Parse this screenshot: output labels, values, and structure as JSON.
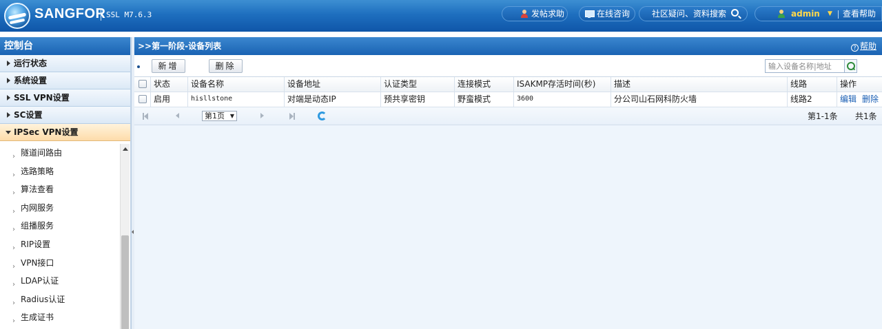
{
  "header": {
    "brand": "SANGFOR",
    "version": "SSL M7.6.3",
    "post_help": "发帖求助",
    "online_consult": "在线咨询",
    "community": "社区疑问、资料搜索",
    "user": "admin",
    "view_help": "查看帮助"
  },
  "sidebar": {
    "title": "控制台",
    "groups": [
      "运行状态",
      "系统设置",
      "SSL VPN设置",
      "SC设置",
      "IPSec VPN设置"
    ],
    "sub_items": [
      "隧道间路由",
      "选路策略",
      "算法查看",
      "内网服务",
      "组播服务",
      "RIP设置",
      "VPN接口",
      "LDAP认证",
      "Radius认证",
      "生成证书"
    ]
  },
  "main": {
    "title": ">>第一阶段-设备列表",
    "help": "帮助",
    "toolbar": {
      "add": "新增",
      "delete": "删除",
      "search_placeholder": "输入设备名称|地址"
    },
    "table": {
      "headers": [
        "状态",
        "设备名称",
        "设备地址",
        "认证类型",
        "连接模式",
        "ISAKMP存活时间(秒)",
        "描述",
        "线路",
        "操作"
      ],
      "rows": [
        {
          "status": "启用",
          "name": "hisllstone",
          "address": "对端是动态IP",
          "auth": "预共享密钥",
          "mode": "野蛮模式",
          "isakmp": "3600",
          "desc": "分公司山石网科防火墙",
          "line": "线路2",
          "edit": "编辑",
          "del": "删除"
        }
      ]
    },
    "pager": {
      "page": "第1页",
      "range": "第1-1条",
      "total": "共1条"
    }
  },
  "colors": {
    "header_blue": "#1e6fbf",
    "admin_yellow": "#ffd84a",
    "link_blue": "#1a5fb4",
    "active_group": "#fddcaa"
  }
}
